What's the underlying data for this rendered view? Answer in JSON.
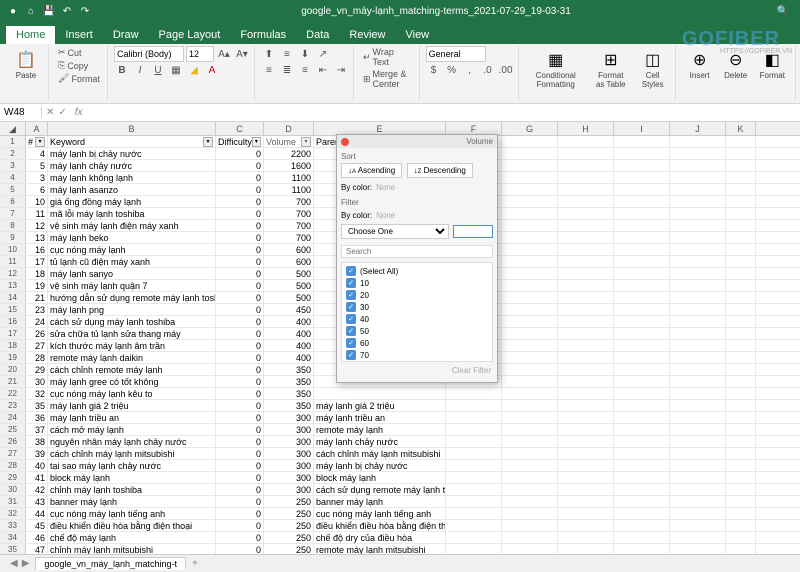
{
  "title_bar": {
    "filename": "google_vn_máy-lạnh_matching-terms_2021-07-29_19-03-31"
  },
  "ribbon": {
    "tabs": [
      "Home",
      "Insert",
      "Draw",
      "Page Layout",
      "Formulas",
      "Data",
      "Review",
      "View"
    ],
    "active_tab": "Home",
    "paste": "Paste",
    "cut": "Cut",
    "copy": "Copy",
    "format_btn": "Format",
    "font": "Calibri (Body)",
    "size": "12",
    "wrap_text": "Wrap Text",
    "merge_center": "Merge & Center",
    "number_format": "General",
    "conditional_formatting": "Conditional Formatting",
    "format_as_table": "Format as Table",
    "cell_styles": "Cell Styles",
    "insert": "Insert",
    "delete": "Delete",
    "format": "Format"
  },
  "name_box": {
    "value": "W48"
  },
  "columns": [
    "A",
    "B",
    "C",
    "D",
    "E",
    "F",
    "G",
    "H",
    "I",
    "J",
    "K"
  ],
  "header_row_num": "1",
  "headers": {
    "num": "#",
    "keyword": "Keyword",
    "difficulty": "Difficulty",
    "volume": "Volume",
    "parent": "Parent Keyword"
  },
  "rows": [
    {
      "n": "2",
      "num": "4",
      "kw": "máy lạnh bị chảy nước",
      "d": "0",
      "v": "2200",
      "p": ""
    },
    {
      "n": "3",
      "num": "5",
      "kw": "máy lạnh chảy nước",
      "d": "0",
      "v": "1600",
      "p": ""
    },
    {
      "n": "4",
      "num": "3",
      "kw": "máy lạnh không lạnh",
      "d": "0",
      "v": "1100",
      "p": ""
    },
    {
      "n": "5",
      "num": "6",
      "kw": "máy lạnh asanzo",
      "d": "0",
      "v": "1100",
      "p": ""
    },
    {
      "n": "6",
      "num": "10",
      "kw": "giá ống đồng máy lạnh",
      "d": "0",
      "v": "700",
      "p": ""
    },
    {
      "n": "7",
      "num": "11",
      "kw": "mã lỗi máy lạnh toshiba",
      "d": "0",
      "v": "700",
      "p": ""
    },
    {
      "n": "8",
      "num": "12",
      "kw": "vệ sinh máy lạnh điện máy xanh",
      "d": "0",
      "v": "700",
      "p": ""
    },
    {
      "n": "9",
      "num": "13",
      "kw": "máy lạnh beko",
      "d": "0",
      "v": "700",
      "p": ""
    },
    {
      "n": "10",
      "num": "16",
      "kw": "cục nóng máy lạnh",
      "d": "0",
      "v": "600",
      "p": ""
    },
    {
      "n": "11",
      "num": "17",
      "kw": "tủ lạnh cũ điện máy xanh",
      "d": "0",
      "v": "600",
      "p": ""
    },
    {
      "n": "12",
      "num": "18",
      "kw": "máy lạnh sanyo",
      "d": "0",
      "v": "500",
      "p": ""
    },
    {
      "n": "13",
      "num": "19",
      "kw": "vệ sinh máy lạnh quận 7",
      "d": "0",
      "v": "500",
      "p": ""
    },
    {
      "n": "14",
      "num": "21",
      "kw": "hướng dẫn sử dụng remote máy lạnh toshiba",
      "d": "0",
      "v": "500",
      "p": ""
    },
    {
      "n": "15",
      "num": "23",
      "kw": "máy lạnh png",
      "d": "0",
      "v": "450",
      "p": ""
    },
    {
      "n": "16",
      "num": "24",
      "kw": "cách sử dụng máy lạnh toshiba",
      "d": "0",
      "v": "400",
      "p": ""
    },
    {
      "n": "17",
      "num": "26",
      "kw": "sửa chữa tủ lạnh sửa thang máy",
      "d": "0",
      "v": "400",
      "p": ""
    },
    {
      "n": "18",
      "num": "27",
      "kw": "kích thước máy lạnh âm trần",
      "d": "0",
      "v": "400",
      "p": ""
    },
    {
      "n": "19",
      "num": "28",
      "kw": "remote máy lạnh daikin",
      "d": "0",
      "v": "400",
      "p": ""
    },
    {
      "n": "20",
      "num": "29",
      "kw": "cách chỉnh remote máy lạnh",
      "d": "0",
      "v": "350",
      "p": ""
    },
    {
      "n": "21",
      "num": "30",
      "kw": "máy lạnh gree có tốt không",
      "d": "0",
      "v": "350",
      "p": ""
    },
    {
      "n": "22",
      "num": "32",
      "kw": "cục nóng máy lạnh kêu to",
      "d": "0",
      "v": "350",
      "p": ""
    },
    {
      "n": "23",
      "num": "35",
      "kw": "máy lạnh giá 2 triệu",
      "d": "0",
      "v": "350",
      "p": "máy lạnh giá 2 triệu"
    },
    {
      "n": "24",
      "num": "36",
      "kw": "máy lạnh triều an",
      "d": "0",
      "v": "300",
      "p": "máy lạnh triều an"
    },
    {
      "n": "25",
      "num": "37",
      "kw": "cách mở máy lạnh",
      "d": "0",
      "v": "300",
      "p": "remote máy lạnh"
    },
    {
      "n": "26",
      "num": "38",
      "kw": "nguyên nhân máy lạnh chảy nước",
      "d": "0",
      "v": "300",
      "p": "máy lạnh chảy nước"
    },
    {
      "n": "27",
      "num": "39",
      "kw": "cách chỉnh máy lạnh mitsubishi",
      "d": "0",
      "v": "300",
      "p": "cách chỉnh máy lạnh mitsubishi"
    },
    {
      "n": "28",
      "num": "40",
      "kw": "tại sao máy lạnh chảy nước",
      "d": "0",
      "v": "300",
      "p": "máy lạnh bị chảy nước"
    },
    {
      "n": "29",
      "num": "41",
      "kw": "block máy lạnh",
      "d": "0",
      "v": "300",
      "p": "block máy lạnh"
    },
    {
      "n": "30",
      "num": "42",
      "kw": "chỉnh máy lạnh toshiba",
      "d": "0",
      "v": "300",
      "p": "cách sử dụng remote máy lạnh toshiba"
    },
    {
      "n": "31",
      "num": "43",
      "kw": "banner máy lạnh",
      "d": "0",
      "v": "250",
      "p": "banner máy lạnh"
    },
    {
      "n": "32",
      "num": "44",
      "kw": "cục nóng máy lạnh tiếng anh",
      "d": "0",
      "v": "250",
      "p": "cục nóng máy lạnh tiếng anh"
    },
    {
      "n": "33",
      "num": "45",
      "kw": "điều khiển điều hòa bằng điện thoại",
      "d": "0",
      "v": "250",
      "p": "điều khiển điều hòa bằng điện thoại"
    },
    {
      "n": "34",
      "num": "46",
      "kw": "chế độ máy lạnh",
      "d": "0",
      "v": "250",
      "p": "chế độ dry của điều hòa"
    },
    {
      "n": "35",
      "num": "47",
      "kw": "chỉnh máy lạnh mitsubishi",
      "d": "0",
      "v": "250",
      "p": "remote máy lạnh mitsubishi"
    }
  ],
  "filter_popup": {
    "header_label": "Volume",
    "sort_label": "Sort",
    "ascending": "Ascending",
    "descending": "Descending",
    "by_color": "By color:",
    "none": "None",
    "filter_label": "Filter",
    "choose_one": "Choose One",
    "search_placeholder": "Search",
    "select_all": "(Select All)",
    "options": [
      "10",
      "20",
      "30",
      "40",
      "50",
      "60",
      "70"
    ],
    "clear": "Clear Filter"
  },
  "sheet_tabs": {
    "active": "google_vn_máy_lạnh_matching-t"
  },
  "watermark": {
    "main": "GOFIBER",
    "sub": "HTTPS://GOFIBER.VN"
  }
}
